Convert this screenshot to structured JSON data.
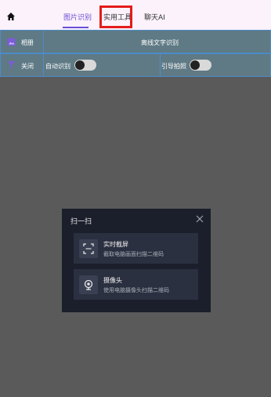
{
  "header": {
    "tabs": [
      {
        "label": "图片识别",
        "active": true
      },
      {
        "label": "实用工具",
        "active": false,
        "highlighted": true
      },
      {
        "label": "聊天AI",
        "active": false
      }
    ],
    "accent_color": "#6a4fd6",
    "highlight_color": "#e31b1b"
  },
  "toolbar": {
    "album_label": "相册",
    "center_title": "离线文字识别",
    "close_label": "关闭",
    "auto_recognize_label": "自动识别",
    "auto_recognize_on": false,
    "guide_photo_label": "引导拍照",
    "guide_photo_on": false
  },
  "dialog": {
    "title": "扫一扫",
    "options": [
      {
        "title": "实时截屏",
        "desc": "截取电脑画面扫描二维码",
        "icon": "scan-frame-icon"
      },
      {
        "title": "摄像头",
        "desc": "使用电脑摄像头扫描二维码",
        "icon": "webcam-icon"
      }
    ]
  }
}
